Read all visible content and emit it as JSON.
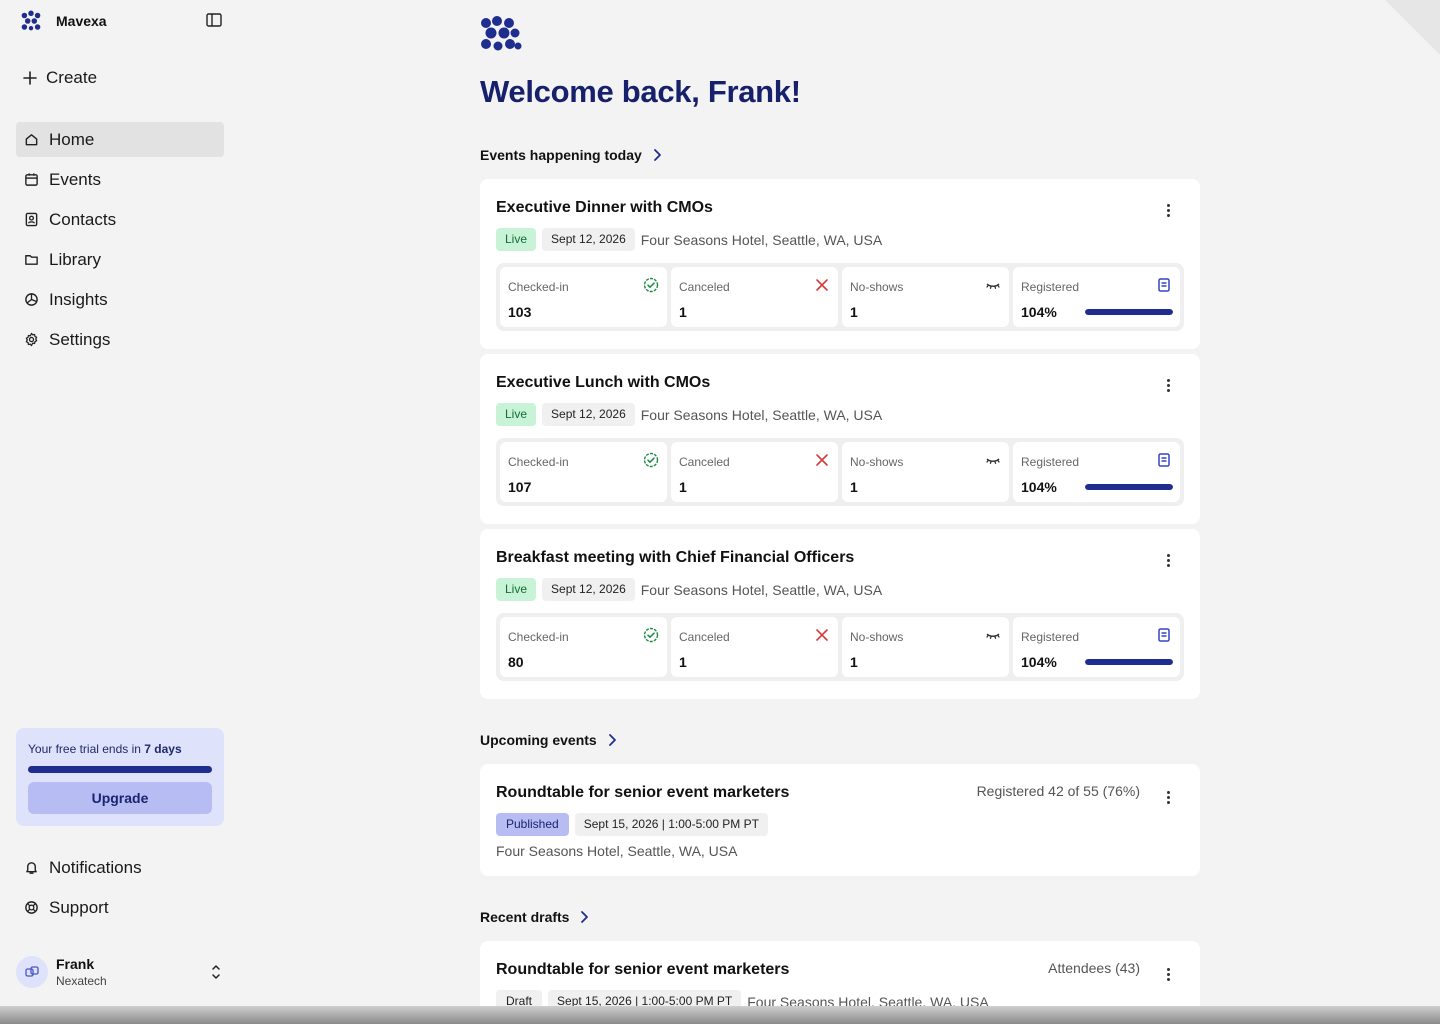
{
  "app": {
    "name": "Mavexa"
  },
  "sidebar": {
    "create_label": "Create",
    "items": [
      {
        "label": "Home",
        "icon": "home-icon",
        "active": true
      },
      {
        "label": "Events",
        "icon": "calendar-icon"
      },
      {
        "label": "Contacts",
        "icon": "contacts-icon"
      },
      {
        "label": "Library",
        "icon": "folder-icon"
      },
      {
        "label": "Insights",
        "icon": "insights-icon"
      },
      {
        "label": "Settings",
        "icon": "gear-icon"
      }
    ],
    "trial": {
      "text_prefix": "Your free trial ends in ",
      "days": "7 days",
      "progress_fraction": 1.0,
      "upgrade_label": "Upgrade"
    },
    "bottom_items": [
      {
        "label": "Notifications",
        "icon": "bell-icon"
      },
      {
        "label": "Support",
        "icon": "lifebuoy-icon"
      }
    ],
    "user": {
      "name": "Frank",
      "org": "Nexatech"
    }
  },
  "main": {
    "welcome": "Welcome back, Frank!",
    "today_title": "Events happening today",
    "today_events": [
      {
        "title": "Executive Dinner with CMOs",
        "status": "Live",
        "date": "Sept 12, 2026",
        "location": "Four Seasons Hotel, Seattle, WA, USA",
        "stats": {
          "checked_in_label": "Checked-in",
          "checked_in": "103",
          "canceled_label": "Canceled",
          "canceled": "1",
          "noshows_label": "No-shows",
          "noshows": "1",
          "registered_label": "Registered",
          "registered": "104%",
          "registered_fraction": 1.0
        }
      },
      {
        "title": "Executive Lunch with CMOs",
        "status": "Live",
        "date": "Sept 12, 2026",
        "location": "Four Seasons Hotel, Seattle, WA, USA",
        "stats": {
          "checked_in_label": "Checked-in",
          "checked_in": "107",
          "canceled_label": "Canceled",
          "canceled": "1",
          "noshows_label": "No-shows",
          "noshows": "1",
          "registered_label": "Registered",
          "registered": "104%",
          "registered_fraction": 1.0
        }
      },
      {
        "title": "Breakfast meeting with Chief Financial Officers",
        "status": "Live",
        "date": "Sept 12, 2026",
        "location": "Four Seasons Hotel, Seattle, WA, USA",
        "stats": {
          "checked_in_label": "Checked-in",
          "checked_in": "80",
          "canceled_label": "Canceled",
          "canceled": "1",
          "noshows_label": "No-shows",
          "noshows": "1",
          "registered_label": "Registered",
          "registered": "104%",
          "registered_fraction": 1.0
        }
      }
    ],
    "upcoming_title": "Upcoming events",
    "upcoming": {
      "title": "Roundtable for senior event marketers",
      "status": "Published",
      "date": "Sept 15, 2026 | 1:00-5:00 PM PT",
      "location": "Four Seasons Hotel, Seattle, WA, USA",
      "registered": "Registered 42 of 55 (76%)"
    },
    "drafts_title": "Recent drafts",
    "draft": {
      "title": "Roundtable for senior event marketers",
      "status": "Draft",
      "date": "Sept 15, 2026 | 1:00-5:00 PM PT",
      "location": "Four Seasons Hotel, Seattle, WA, USA",
      "attendees": "Attendees (43)"
    }
  },
  "colors": {
    "brand": "#1f2d8f",
    "heading": "#17206b",
    "live_bg": "#c8f3d6",
    "published_bg": "#b7bdf2",
    "check_green": "#1f8a48",
    "cancel_red": "#d83a3a"
  }
}
